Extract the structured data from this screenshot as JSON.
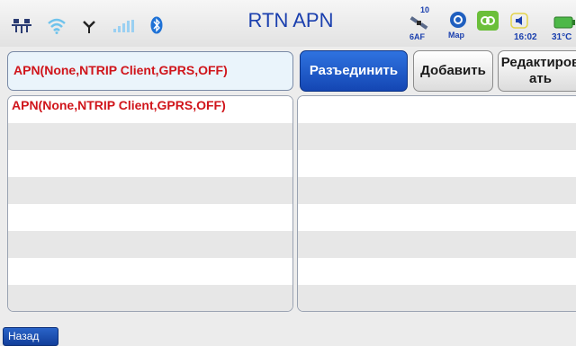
{
  "status_bar": {
    "title": "RTN APN",
    "satellite_count": "10",
    "satellite_label": "6AF",
    "map_label": "Map",
    "time": "16:02",
    "temperature": "31°C",
    "icons": [
      "network-icon",
      "wifi-icon",
      "antenna-icon",
      "signal-icon",
      "bluetooth-icon",
      "satellite-icon",
      "map-icon",
      "link-icon",
      "speaker-icon",
      "battery-icon"
    ]
  },
  "apn_field": {
    "value": "APN(None,NTRIP Client,GPRS,OFF)"
  },
  "buttons": {
    "disconnect": "Разъединить",
    "add": "Добавить",
    "edit": "Редактировать"
  },
  "left_list": {
    "rows": [
      "APN(None,NTRIP Client,GPRS,OFF)",
      "",
      "",
      "",
      "",
      "",
      "",
      ""
    ]
  },
  "right_list": {
    "rows": [
      "",
      "",
      "",
      "",
      "",
      "",
      "",
      ""
    ]
  },
  "back_button": {
    "label": "Назад"
  },
  "colors": {
    "accent_blue": "#1a3fae",
    "apn_text_red": "#d0151b",
    "button_blue": "#1446b3"
  }
}
